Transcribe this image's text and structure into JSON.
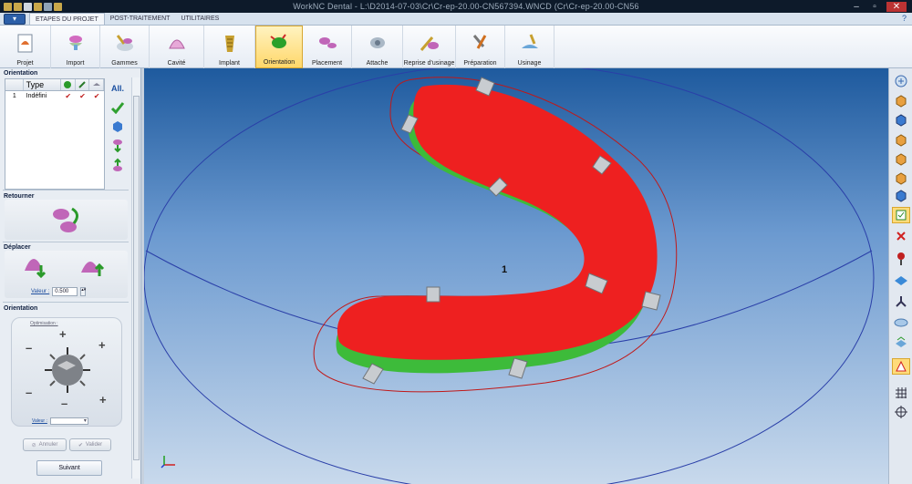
{
  "window": {
    "title": "WorkNC Dental - L:\\D2014-07-03\\Cr\\Cr-ep-20.00-CN567394.WNCD (Cr\\Cr-ep-20.00-CN56"
  },
  "tabs": [
    {
      "label": "ETAPES DU PROJET",
      "active": true
    },
    {
      "label": "POST-TRAITEMENT",
      "active": false
    },
    {
      "label": "UTILITAIRES",
      "active": false
    }
  ],
  "ribbon": [
    {
      "label": "Projet",
      "icon": "project-icon"
    },
    {
      "label": "Import",
      "icon": "import-icon"
    },
    {
      "label": "Gammes",
      "icon": "gammes-icon"
    },
    {
      "label": "Cavité",
      "icon": "cavity-icon"
    },
    {
      "label": "Implant",
      "icon": "implant-icon"
    },
    {
      "label": "Orientation",
      "icon": "orientation-icon",
      "active": true
    },
    {
      "label": "Placement",
      "icon": "placement-icon"
    },
    {
      "label": "Attache",
      "icon": "attache-icon"
    },
    {
      "label": "Reprise d'usinage",
      "icon": "reprise-icon"
    },
    {
      "label": "Préparation",
      "icon": "preparation-icon"
    },
    {
      "label": "Usinage",
      "icon": "usinage-icon"
    }
  ],
  "left_panel": {
    "orientation_title": "Orientation",
    "table": {
      "header": "Type",
      "rows": [
        {
          "index": "1",
          "type": "Indéfini"
        }
      ]
    },
    "all_label": "All.",
    "retourner_title": "Retourner",
    "deplacer_title": "Déplacer",
    "deplacer_value_label": "Valeur :",
    "deplacer_value": "0.500",
    "orientation2_title": "Orientation",
    "optimisation_label": "Optimisation :",
    "orient_value_label": "Valeur :",
    "annuler_label": "Annuler",
    "valider_label": "Valider",
    "suivant_label": "Suivant"
  },
  "viewport": {
    "part_label": "1"
  },
  "colors": {
    "model_red": "#ee2020",
    "model_green": "#3dbb3a",
    "outline_red": "#c01818",
    "sphere_blue": "#2a3fa8"
  }
}
